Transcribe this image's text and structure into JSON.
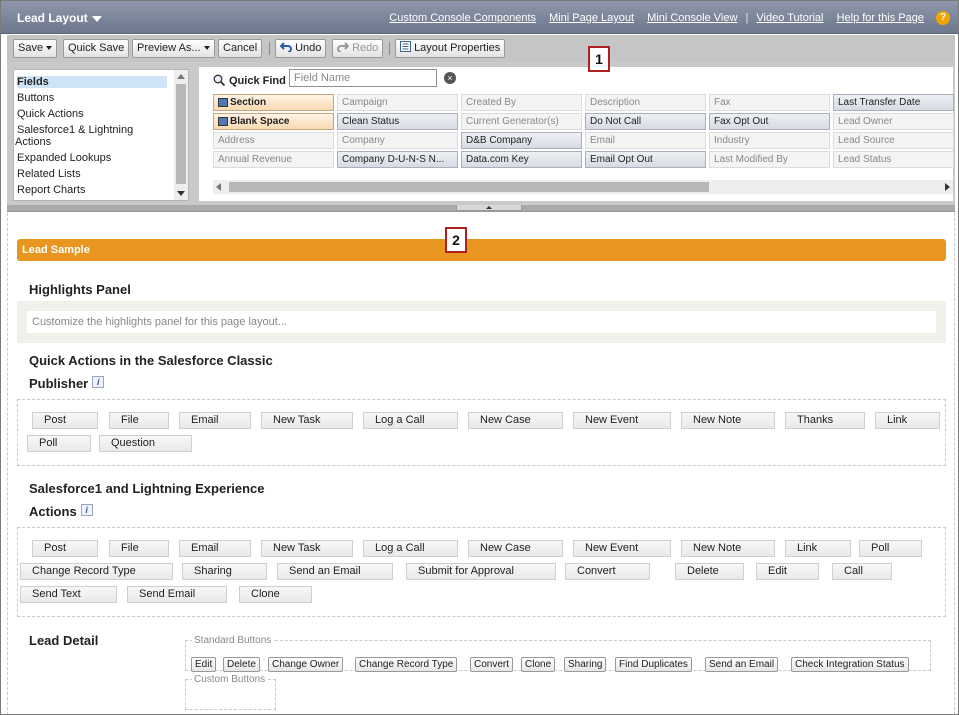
{
  "header": {
    "title": "Lead Layout",
    "links": [
      "Custom Console Components",
      "Mini Page Layout",
      "Mini Console View",
      "Video Tutorial",
      "Help for this Page"
    ],
    "help_icon": "?"
  },
  "toolbar": {
    "save": "Save",
    "quick_save": "Quick Save",
    "preview_as": "Preview As...",
    "cancel": "Cancel",
    "undo": "Undo",
    "redo": "Redo",
    "layout_properties": "Layout Properties"
  },
  "palette": {
    "categories": [
      "Fields",
      "Buttons",
      "Quick Actions",
      "Salesforce1 & Lightning",
      "Actions",
      "Expanded Lookups",
      "Related Lists",
      "Report Charts"
    ],
    "selected_category": "Fields",
    "quick_find": {
      "label": "Quick Find",
      "placeholder": "Field Name",
      "clear": "×"
    },
    "fields": [
      [
        "Section",
        "Campaign",
        "Created By",
        "Description",
        "Fax",
        "Last Transfer Date"
      ],
      [
        "Blank Space",
        "Clean Status",
        "Current Generator(s)",
        "Do Not Call",
        "Fax Opt Out",
        "Lead Owner"
      ],
      [
        "Address",
        "Company",
        "D&B Company",
        "Email",
        "Industry",
        "Lead Source"
      ],
      [
        "Annual Revenue",
        "Company D-U-N-S N...",
        "Data.com Key",
        "Email Opt Out",
        "Last Modified By",
        "Lead Status"
      ]
    ]
  },
  "callouts": [
    "1",
    "2"
  ],
  "layout": {
    "bar_title": "Lead Sample",
    "highlights": {
      "title": "Highlights Panel",
      "placeholder": "Customize the highlights panel for this page layout..."
    },
    "classic_publisher": {
      "title_line1": "Quick Actions in the Salesforce Classic",
      "title_line2": "Publisher",
      "info": "i",
      "actions": [
        "Post",
        "File",
        "Email",
        "New Task",
        "Log a Call",
        "New Case",
        "New Event",
        "New Note",
        "Thanks",
        "Link",
        "Poll",
        "Question"
      ]
    },
    "lightning_actions": {
      "title_line1": "Salesforce1 and Lightning Experience",
      "title_line2": "Actions",
      "info": "i",
      "actions": [
        "Post",
        "File",
        "Email",
        "New Task",
        "Log a Call",
        "New Case",
        "New Event",
        "New Note",
        "Link",
        "Poll",
        "Change Record Type",
        "Sharing",
        "Send an Email",
        "Submit for Approval",
        "Convert",
        "Delete",
        "Edit",
        "Call",
        "Send Text",
        "Send Email",
        "Clone"
      ]
    },
    "lead_detail": {
      "title": "Lead Detail",
      "standard_caption": "Standard Buttons",
      "standard_buttons": [
        "Edit",
        "Delete",
        "Change Owner",
        "Change Record Type",
        "Convert",
        "Clone",
        "Sharing",
        "Find Duplicates",
        "Send an Email",
        "Check Integration Status"
      ],
      "custom_caption": "Custom Buttons"
    }
  }
}
